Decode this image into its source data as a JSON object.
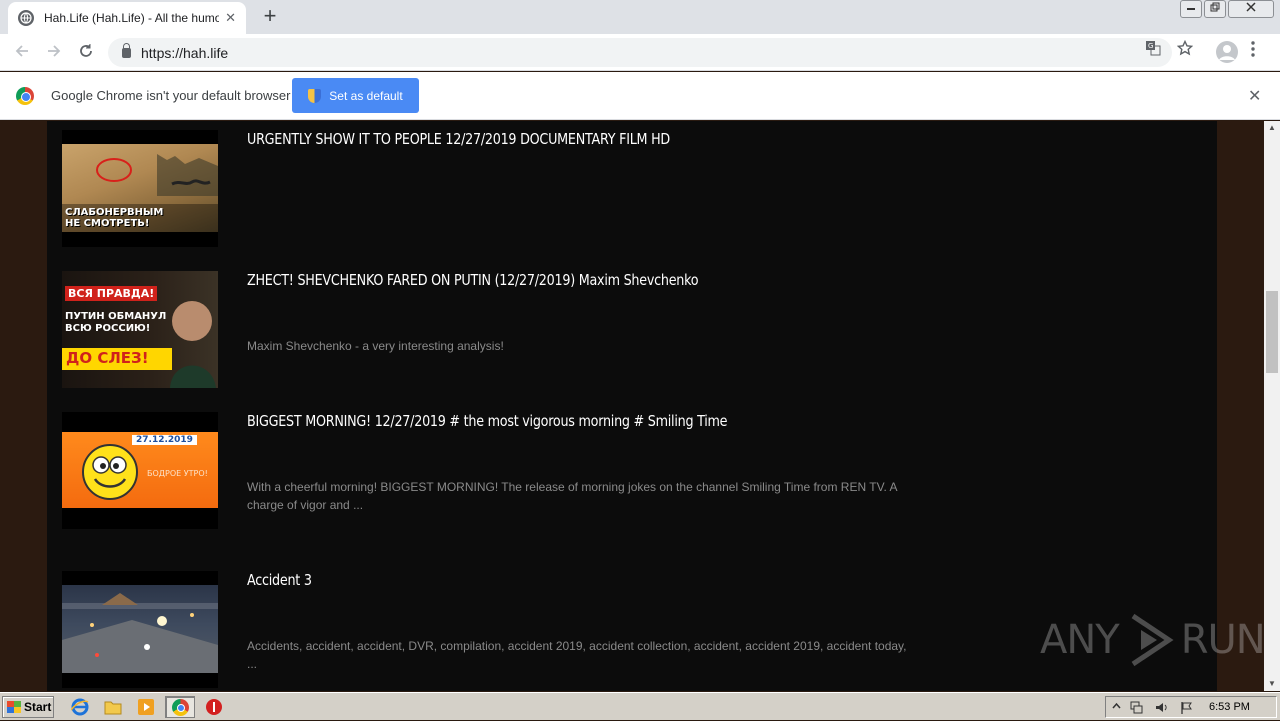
{
  "browser": {
    "tab_title": "Hah.Life (Hah.Life) - All the humor in",
    "tab_close": "✕",
    "new_tab": "+",
    "url": "https://hah.life",
    "window_controls": {
      "minimize": "▭",
      "restore": "❐",
      "close": "✕"
    }
  },
  "infobar": {
    "message": "Google Chrome isn't your default browser",
    "button_label": "Set as default",
    "close": "✕"
  },
  "videos": [
    {
      "title": "URGENTLY SHOW IT TO PEOPLE 12/27/2019 DOCUMENTARY FILM HD",
      "description": "",
      "thumb_caption": "СЛАБОНЕРВНЫМ НЕ СМОТРЕТЬ!"
    },
    {
      "title": "ZHECT! SHEVCHENKO FARED ON PUTIN (12/27/2019) Maxim Shevchenko",
      "description": "Maxim Shevchenko - a very interesting analysis!",
      "thumb_caption_1": "ВСЯ ПРАВДА!",
      "thumb_caption_2": "ПУТИН ОБМАНУЛ ВСЮ РОССИЮ!",
      "thumb_caption_3": "ДО СЛЕЗ!"
    },
    {
      "title": "BIGGEST MORNING! 12/27/2019 # the most vigorous morning # Smiling Time",
      "description": "With a cheerful morning! BIGGEST MORNING! The release of morning jokes on the channel Smiling Time from REN TV. A charge of vigor and ...",
      "thumb_date": "27.12.2019",
      "thumb_text": "БОДРОЕ УТРО!"
    },
    {
      "title": "Accident 3",
      "description": "Accidents, accident, accident, DVR, compilation, accident 2019, accident collection, accident, accident 2019, accident today, ..."
    }
  ],
  "taskbar": {
    "start_label": "Start",
    "clock": "6:53 PM"
  },
  "watermark": {
    "left": "ANY",
    "right": "RUN"
  },
  "colors": {
    "page_bg": "#2b1a10",
    "content_bg": "#0c0c0c",
    "accent_button": "#4a8af4"
  }
}
